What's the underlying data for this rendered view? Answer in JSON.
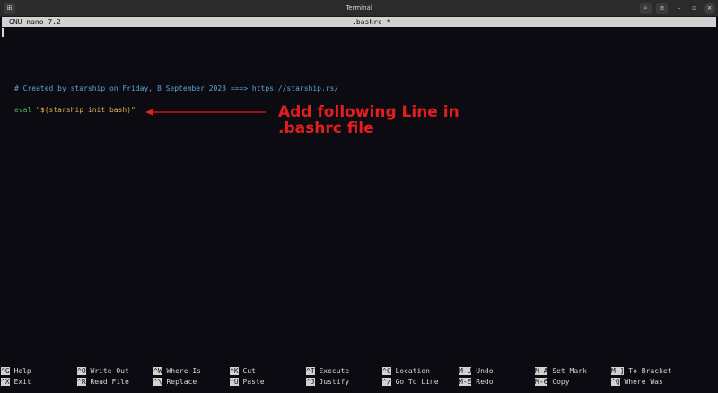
{
  "window": {
    "title": "Terminal"
  },
  "nano": {
    "version": "GNU nano 7.2",
    "filename": ".bashrc *"
  },
  "editor": {
    "comment": "# Created by starship on Friday, 8 September 2023 ===> https://starship.rs/",
    "eval_keyword": "eval",
    "eval_arg": "\"$(starship init bash)\""
  },
  "annotation": {
    "text_line1": "Add following Line in",
    "text_line2": ".bashrc file",
    "color": "#e41d1d"
  },
  "shortcuts": [
    {
      "key": "^G",
      "label": "Help"
    },
    {
      "key": "^X",
      "label": "Exit"
    },
    {
      "key": "^O",
      "label": "Write Out"
    },
    {
      "key": "^R",
      "label": "Read File"
    },
    {
      "key": "^W",
      "label": "Where Is"
    },
    {
      "key": "^\\",
      "label": "Replace"
    },
    {
      "key": "^K",
      "label": "Cut"
    },
    {
      "key": "^U",
      "label": "Paste"
    },
    {
      "key": "^T",
      "label": "Execute"
    },
    {
      "key": "^J",
      "label": "Justify"
    },
    {
      "key": "^C",
      "label": "Location"
    },
    {
      "key": "^/",
      "label": "Go To Line"
    },
    {
      "key": "M-U",
      "label": "Undo"
    },
    {
      "key": "M-E",
      "label": "Redo"
    },
    {
      "key": "M-A",
      "label": "Set Mark"
    },
    {
      "key": "M-6",
      "label": "Copy"
    },
    {
      "key": "M-]",
      "label": "To Bracket"
    },
    {
      "key": "^Q",
      "label": "Where Was"
    }
  ],
  "colors": {
    "background": "#0b0b11",
    "comment": "#5aa6d4",
    "keyword": "#48b25c",
    "string": "#e0b24d",
    "bar": "#d2d2d2"
  }
}
